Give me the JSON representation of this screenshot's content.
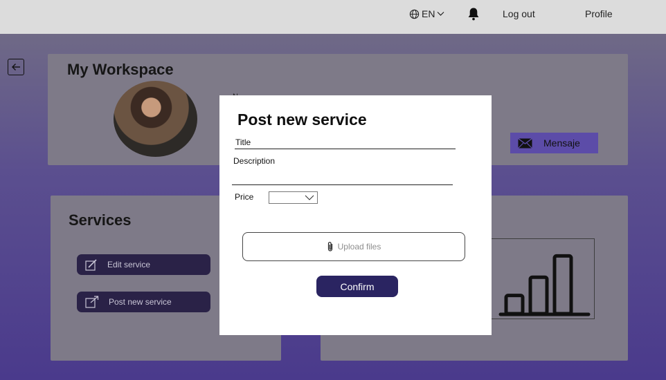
{
  "topbar": {
    "language": "EN",
    "logout_label": "Log out",
    "profile_label": "Profile"
  },
  "workspace": {
    "title": "My Workspace",
    "name_hint": "N",
    "message_button": "Mensaje"
  },
  "services": {
    "title": "Services",
    "edit_label": "Edit service",
    "post_label": "Post new service"
  },
  "modal": {
    "title": "Post new service",
    "title_label": "Title",
    "description_label": "Description",
    "price_label": "Price",
    "upload_label": "Upload files",
    "confirm_label": "Confirm"
  },
  "stats_chart": {
    "bar_levels": [
      0.3,
      0.6,
      0.95
    ],
    "bar_color": "#111111"
  },
  "colors": {
    "topbar": "#dcdcdc",
    "accent": "#2a2461",
    "message_button": "#5c4ca8"
  }
}
